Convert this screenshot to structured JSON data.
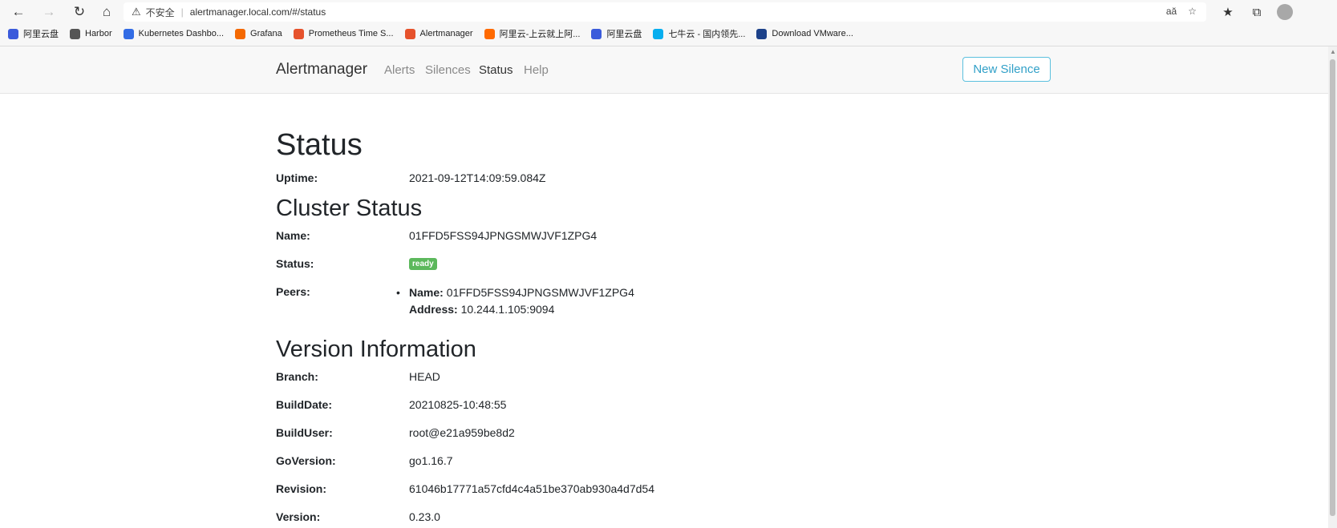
{
  "browser": {
    "address": {
      "insecure_label": "不安全",
      "url": "alertmanager.local.com/#/status"
    },
    "bookmarks": [
      {
        "label": "阿里云盘",
        "icon": "aliyun-drive-icon",
        "color": "#3b5bdb"
      },
      {
        "label": "Harbor",
        "icon": "harbor-icon",
        "color": "#555555"
      },
      {
        "label": "Kubernetes Dashbo...",
        "icon": "kubernetes-icon",
        "color": "#326ce5"
      },
      {
        "label": "Grafana",
        "icon": "grafana-icon",
        "color": "#f46800"
      },
      {
        "label": "Prometheus Time S...",
        "icon": "prometheus-icon",
        "color": "#e6522c"
      },
      {
        "label": "Alertmanager",
        "icon": "alertmanager-icon",
        "color": "#e6522c"
      },
      {
        "label": "阿里云-上云就上阿...",
        "icon": "aliyun-icon",
        "color": "#ff6a00"
      },
      {
        "label": "阿里云盘",
        "icon": "aliyun-drive-icon",
        "color": "#3b5bdb"
      },
      {
        "label": "七牛云 - 国内领先...",
        "icon": "qiniu-icon",
        "color": "#06aeef"
      },
      {
        "label": "Download VMware...",
        "icon": "vmware-icon",
        "color": "#1d428a"
      }
    ]
  },
  "navbar": {
    "brand": "Alertmanager",
    "links": [
      "Alerts",
      "Silences",
      "Status",
      "Help"
    ],
    "active": "Status",
    "new_silence": "New Silence"
  },
  "status": {
    "title": "Status",
    "uptime_label": "Uptime:",
    "uptime": "2021-09-12T14:09:59.084Z"
  },
  "cluster": {
    "title": "Cluster Status",
    "name_label": "Name:",
    "name": "01FFD5FSS94JPNGSMWJVF1ZPG4",
    "status_label": "Status:",
    "status": "ready",
    "peers_label": "Peers:",
    "peer_name_label": "Name:",
    "peer_name": "01FFD5FSS94JPNGSMWJVF1ZPG4",
    "peer_address_label": "Address:",
    "peer_address": "10.244.1.105:9094"
  },
  "version": {
    "title": "Version Information",
    "rows": [
      {
        "label": "Branch:",
        "value": "HEAD"
      },
      {
        "label": "BuildDate:",
        "value": "20210825-10:48:55"
      },
      {
        "label": "BuildUser:",
        "value": "root@e21a959be8d2"
      },
      {
        "label": "GoVersion:",
        "value": "go1.16.7"
      },
      {
        "label": "Revision:",
        "value": "61046b17771a57cfd4c4a51be370ab930a4d7d54"
      },
      {
        "label": "Version:",
        "value": "0.23.0"
      }
    ]
  }
}
